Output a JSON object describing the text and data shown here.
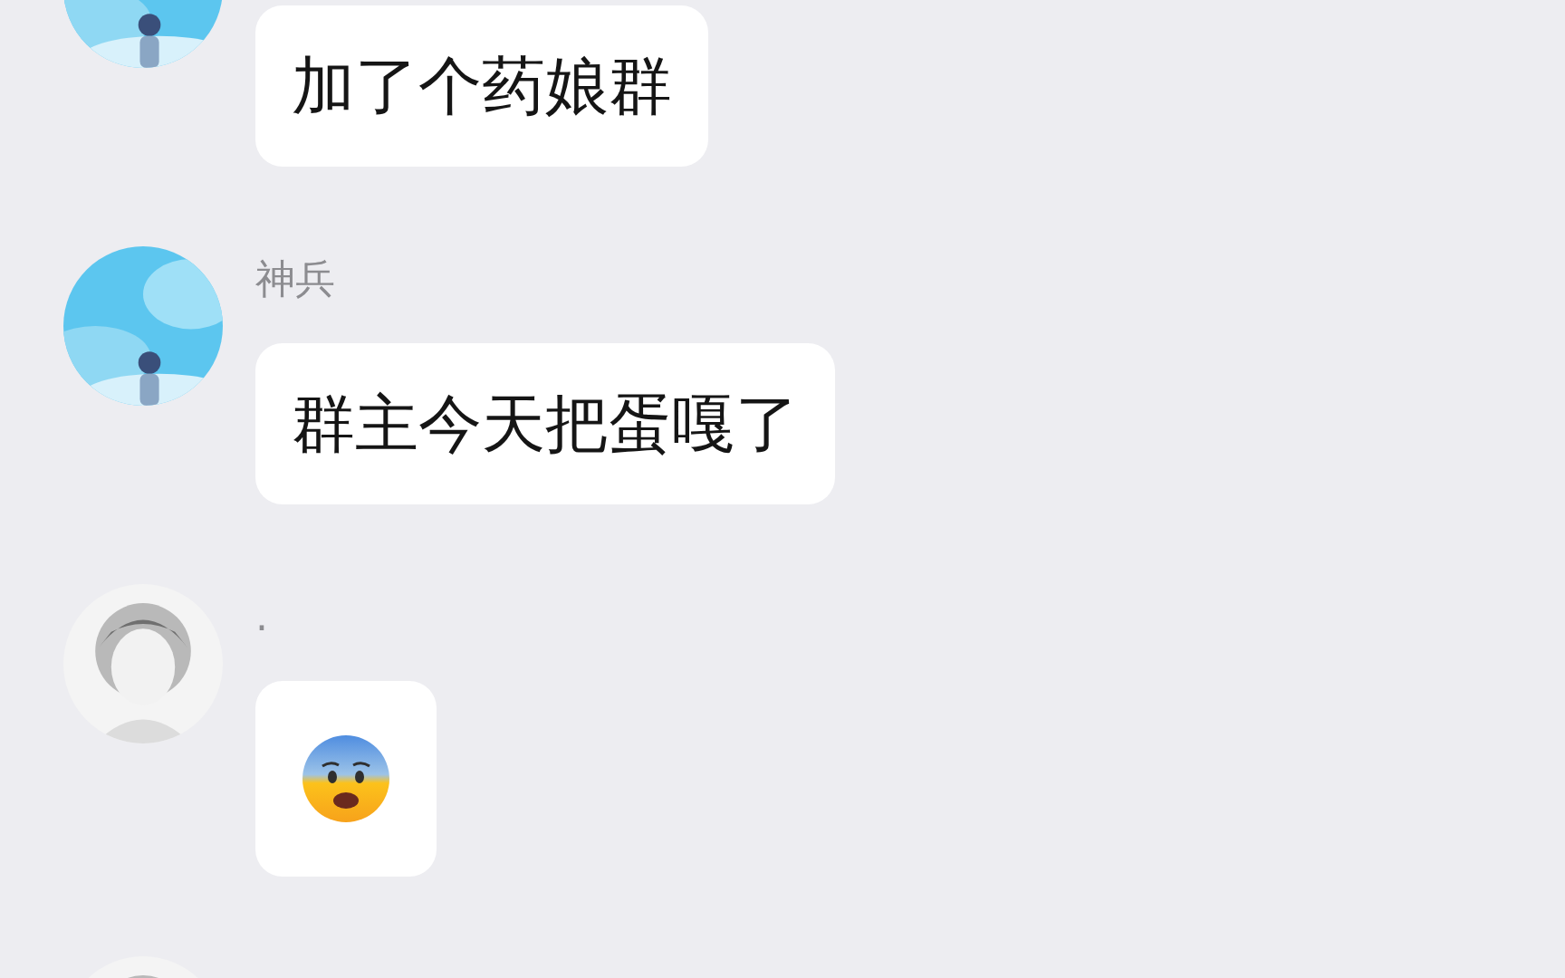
{
  "messages": [
    {
      "kind": "text",
      "text": "加了个药娘群"
    },
    {
      "kind": "text",
      "sender": "神兵",
      "text": "群主今天把蛋嘎了"
    },
    {
      "kind": "emoji",
      "sender": "."
    },
    {
      "kind": "cut"
    }
  ]
}
